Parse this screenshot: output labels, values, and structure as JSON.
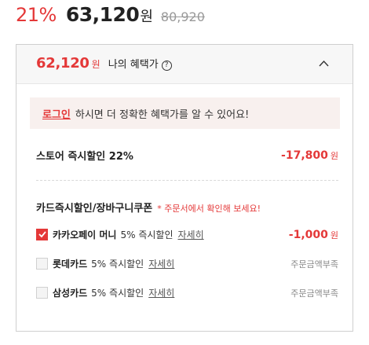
{
  "price": {
    "discount_rate": "21%",
    "sale_price": "63,120",
    "won": "원",
    "original_price": "80,920"
  },
  "benefit_panel": {
    "my_price": "62,120",
    "my_price_unit": "원",
    "label": "나의 혜택가",
    "info_glyph": "?",
    "login_link": "로그인",
    "login_message": "하시면 더 정확한 혜택가를 알 수 있어요!",
    "store_discount": {
      "title": "스토어 즉시할인 22%",
      "amount": "-17,800",
      "unit": "원"
    },
    "coupon_section": {
      "title": "카드즉시할인/장바구니쿠폰",
      "note": "* 주문서에서 확인해 보세요!"
    },
    "cards": [
      {
        "name": "카카오페이 머니",
        "desc": "5% 즉시할인",
        "detail": "자세히",
        "checked": true,
        "amount": "-1,000",
        "unit": "원",
        "status": ""
      },
      {
        "name": "롯데카드",
        "desc": "5% 즉시할인",
        "detail": "자세히",
        "checked": false,
        "amount": "",
        "unit": "",
        "status": "주문금액부족"
      },
      {
        "name": "삼성카드",
        "desc": "5% 즉시할인",
        "detail": "자세히",
        "checked": false,
        "amount": "",
        "unit": "",
        "status": "주문금액부족"
      }
    ]
  },
  "colors": {
    "accent": "#e43838",
    "panel_header_bg": "#f7f7f7",
    "login_box_bg": "#f8f0ee"
  }
}
